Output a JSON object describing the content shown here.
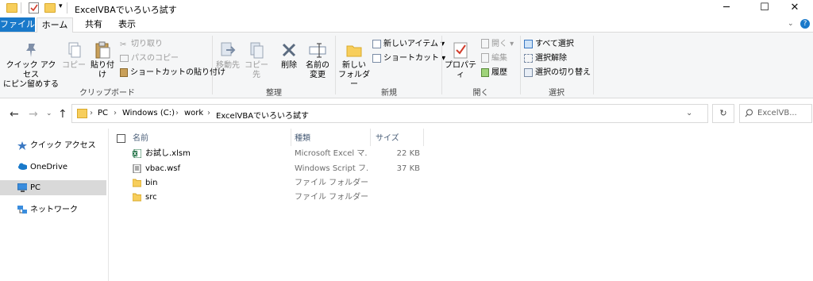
{
  "window": {
    "title": "ExcelVBAでいろいろ試す",
    "controls": {
      "minimize": "─",
      "maximize": "☐",
      "close": "✕"
    }
  },
  "ribbon_tabs": [
    "ファイル",
    "ホーム",
    "共有",
    "表示"
  ],
  "help_glyph": "?",
  "ribbon": {
    "clipboard": {
      "label": "クリップボード",
      "pin": "クイック アクセス\nにピン留めする",
      "copy": "コピー",
      "paste": "貼り付け",
      "cut": "切り取り",
      "copy_path": "パスのコピー",
      "paste_shortcut": "ショートカットの貼り付け"
    },
    "organize": {
      "label": "整理",
      "move_to": "移動先",
      "copy_to": "コピー先",
      "delete": "削除",
      "rename": "名前の\n変更"
    },
    "new": {
      "label": "新規",
      "new_folder": "新しい\nフォルダー",
      "new_item": "新しいアイテム ▾",
      "easy_access": "ショートカット ▾"
    },
    "open": {
      "label": "開く",
      "properties": "プロパティ",
      "open": "開く ▾",
      "edit": "編集",
      "history": "履歴"
    },
    "select": {
      "label": "選択",
      "select_all": "すべて選択",
      "select_none": "選択解除",
      "invert": "選択の切り替え"
    }
  },
  "address": {
    "crumbs": [
      "PC",
      "Windows (C:)",
      "work",
      "ExcelVBAでいろいろ試す"
    ],
    "search_placeholder": "ExcelVB..."
  },
  "nav_pane": [
    {
      "label": "クイック アクセス",
      "icon": "star-icon"
    },
    {
      "label": "OneDrive",
      "icon": "cloud-icon"
    },
    {
      "label": "PC",
      "icon": "pc-icon",
      "selected": true
    },
    {
      "label": "ネットワーク",
      "icon": "network-icon"
    }
  ],
  "columns": {
    "name": "名前",
    "type": "種類",
    "size": "サイズ"
  },
  "files": [
    {
      "name": "お試し.xlsm",
      "type": "Microsoft Excel マ...",
      "size": "22 KB",
      "icon": "excel-file-icon"
    },
    {
      "name": "vbac.wsf",
      "type": "Windows Script フ...",
      "size": "37 KB",
      "icon": "script-file-icon"
    },
    {
      "name": "bin",
      "type": "ファイル フォルダー",
      "size": "",
      "icon": "folder-icon"
    },
    {
      "name": "src",
      "type": "ファイル フォルダー",
      "size": "",
      "icon": "folder-icon"
    }
  ],
  "colors": {
    "accent": "#1979ca",
    "folder": "#f7ce5c",
    "selected_bg": "#d9d9d9"
  }
}
